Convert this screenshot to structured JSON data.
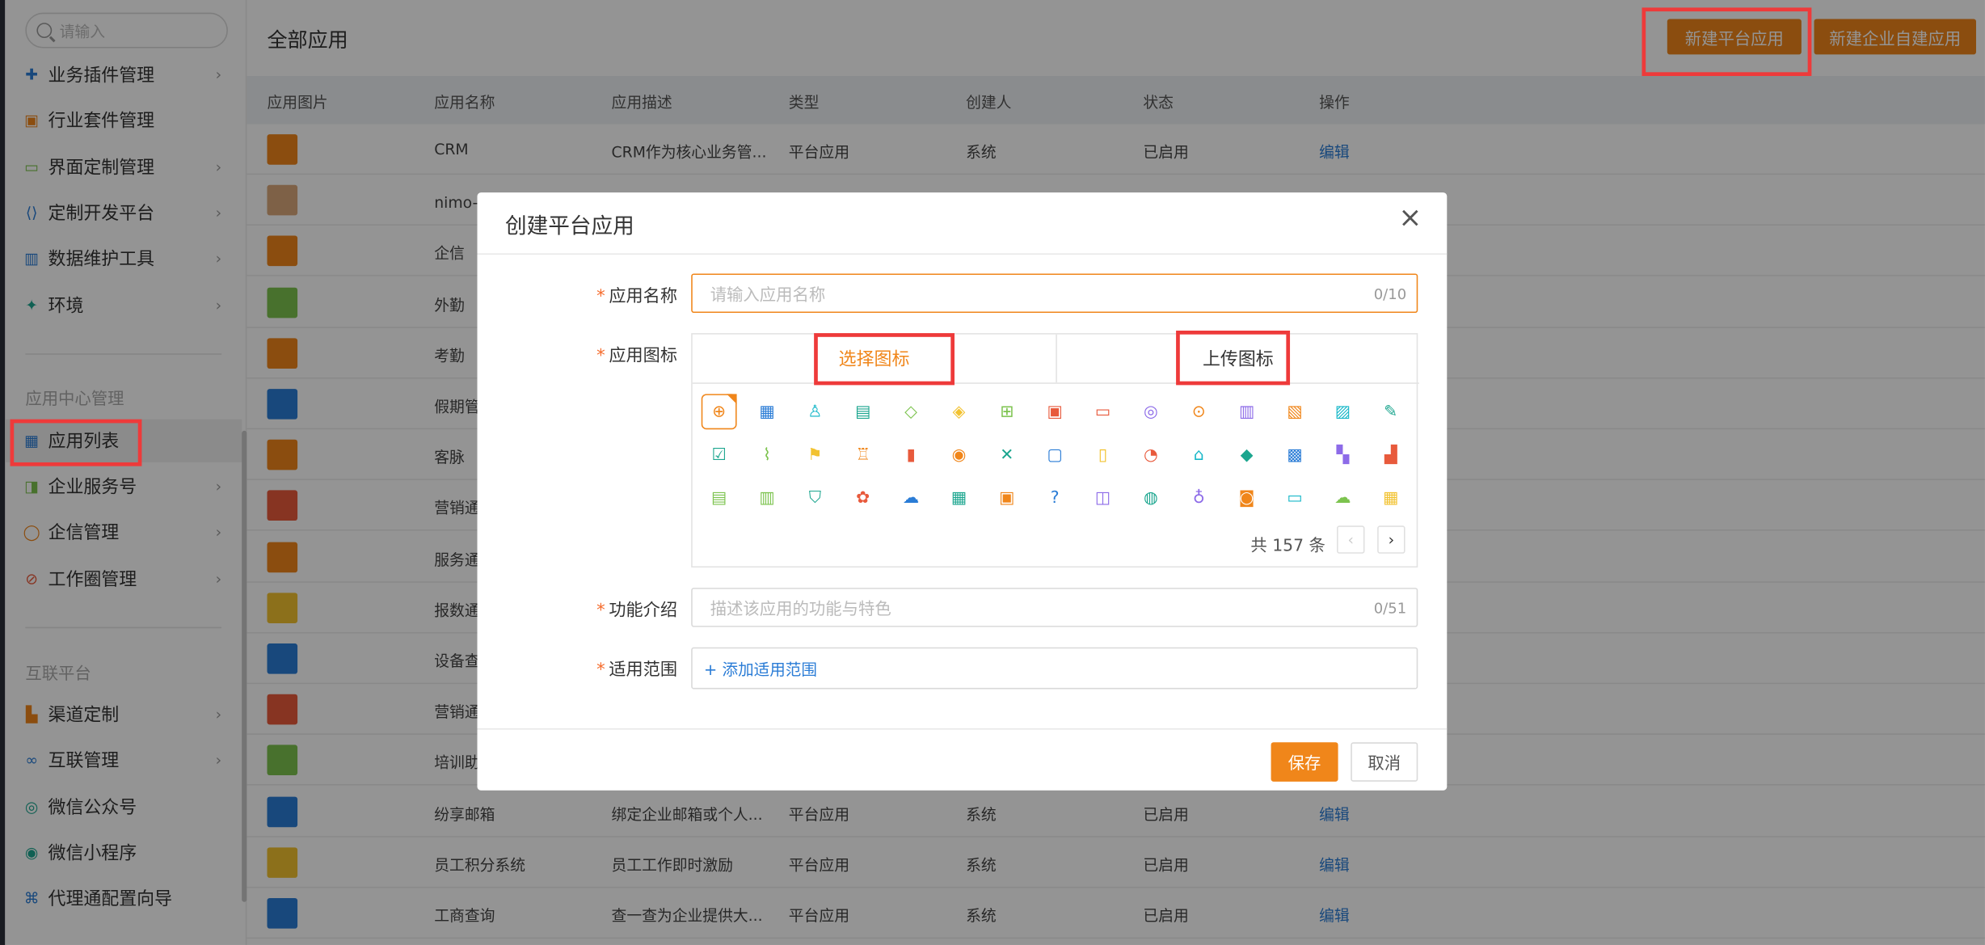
{
  "sidebar": {
    "search_placeholder": "请输入",
    "items": [
      {
        "label": "业务插件管理",
        "icon": "puzzle-icon",
        "chevron": true
      },
      {
        "label": "行业套件管理",
        "icon": "suite-icon",
        "chevron": false
      },
      {
        "label": "界面定制管理",
        "icon": "layout-icon",
        "chevron": true
      },
      {
        "label": "定制开发平台",
        "icon": "code-icon",
        "chevron": true
      },
      {
        "label": "数据维护工具",
        "icon": "bar-chart-icon",
        "chevron": true
      },
      {
        "label": "环境",
        "icon": "environment-icon",
        "chevron": true
      }
    ],
    "section_app_center": "应用中心管理",
    "app_items": [
      {
        "label": "应用列表",
        "icon": "grid-icon",
        "chevron": false
      },
      {
        "label": "企业服务号",
        "icon": "service-icon",
        "chevron": true
      },
      {
        "label": "企信管理",
        "icon": "chat-icon",
        "chevron": true
      },
      {
        "label": "工作圈管理",
        "icon": "edit-circle-icon",
        "chevron": true
      }
    ],
    "section_interconnect": "互联平台",
    "connect_items": [
      {
        "label": "渠道定制",
        "icon": "channel-icon",
        "chevron": true
      },
      {
        "label": "互联管理",
        "icon": "link-icon",
        "chevron": true
      },
      {
        "label": "微信公众号",
        "icon": "wechat-icon",
        "chevron": false
      },
      {
        "label": "微信小程序",
        "icon": "miniprogram-icon",
        "chevron": false
      },
      {
        "label": "代理通配置向导",
        "icon": "agent-icon",
        "chevron": false
      }
    ]
  },
  "main": {
    "title": "全部应用",
    "btn_new_platform": "新建平台应用",
    "btn_new_enterprise": "新建企业自建应用",
    "columns": [
      "应用图片",
      "应用名称",
      "应用描述",
      "类型",
      "创建人",
      "状态",
      "操作"
    ],
    "rows": [
      {
        "name": "CRM",
        "desc": "CRM作为核心业务管...",
        "type": "平台应用",
        "creator": "系统",
        "status": "已启用",
        "action": "编辑",
        "color": "#f0861a"
      },
      {
        "name": "nimo-测",
        "desc": "",
        "type": "",
        "creator": "",
        "status": "",
        "action": "",
        "color": "#d9a77a"
      },
      {
        "name": "企信",
        "desc": "",
        "type": "",
        "creator": "",
        "status": "",
        "action": "",
        "color": "#f0861a"
      },
      {
        "name": "外勤",
        "desc": "",
        "type": "",
        "creator": "",
        "status": "",
        "action": "",
        "color": "#7cc34e"
      },
      {
        "name": "考勤",
        "desc": "",
        "type": "",
        "creator": "",
        "status": "",
        "action": "",
        "color": "#f0861a"
      },
      {
        "name": "假期管",
        "desc": "",
        "type": "",
        "creator": "",
        "status": "",
        "action": "",
        "color": "#2a7cd6"
      },
      {
        "name": "客脉",
        "desc": "",
        "type": "",
        "creator": "",
        "status": "",
        "action": "",
        "color": "#f0861a"
      },
      {
        "name": "营销通",
        "desc": "",
        "type": "",
        "creator": "",
        "status": "",
        "action": "",
        "color": "#e85a3c"
      },
      {
        "name": "服务通",
        "desc": "",
        "type": "",
        "creator": "",
        "status": "",
        "action": "",
        "color": "#f0861a"
      },
      {
        "name": "报数通",
        "desc": "",
        "type": "",
        "creator": "",
        "status": "",
        "action": "",
        "color": "#f2c230"
      },
      {
        "name": "设备查",
        "desc": "",
        "type": "",
        "creator": "",
        "status": "",
        "action": "",
        "color": "#2a7cd6"
      },
      {
        "name": "营销通",
        "desc": "",
        "type": "",
        "creator": "",
        "status": "",
        "action": "",
        "color": "#e85a3c"
      },
      {
        "name": "培训助",
        "desc": "",
        "type": "",
        "creator": "",
        "status": "",
        "action": "",
        "color": "#7cc34e"
      },
      {
        "name": "纷享邮箱",
        "desc": "绑定企业邮箱或个人...",
        "type": "平台应用",
        "creator": "系统",
        "status": "已启用",
        "action": "编辑",
        "color": "#2a7cd6"
      },
      {
        "name": "员工积分系统",
        "desc": "员工工作即时激励",
        "type": "平台应用",
        "creator": "系统",
        "status": "已启用",
        "action": "编辑",
        "color": "#f2c230"
      },
      {
        "name": "工商查询",
        "desc": "查一查为企业提供大...",
        "type": "平台应用",
        "creator": "系统",
        "status": "已启用",
        "action": "编辑",
        "color": "#2a7cd6"
      }
    ]
  },
  "modal": {
    "title": "创建平台应用",
    "close": "×",
    "name_label": "应用名称",
    "name_placeholder": "请输入应用名称",
    "name_count": "0/10",
    "icon_label": "应用图标",
    "tab_select": "选择图标",
    "tab_upload": "上传图标",
    "icons": [
      {
        "glyph": "⊕",
        "color": "#f0861a",
        "selected": true
      },
      {
        "glyph": "▦",
        "color": "#2a7cd6"
      },
      {
        "glyph": "♙",
        "color": "#19b8c9"
      },
      {
        "glyph": "▤",
        "color": "#1ca68f"
      },
      {
        "glyph": "◇",
        "color": "#7cc34e"
      },
      {
        "glyph": "◈",
        "color": "#f2c230"
      },
      {
        "glyph": "⊞",
        "color": "#7cc34e"
      },
      {
        "glyph": "▣",
        "color": "#e85a3c"
      },
      {
        "glyph": "▭",
        "color": "#e85a3c"
      },
      {
        "glyph": "◎",
        "color": "#8d6be8"
      },
      {
        "glyph": "⊙",
        "color": "#f0861a"
      },
      {
        "glyph": "▥",
        "color": "#8d6be8"
      },
      {
        "glyph": "▧",
        "color": "#f0861a"
      },
      {
        "glyph": "▨",
        "color": "#19b8c9"
      },
      {
        "glyph": "✎",
        "color": "#1ca68f"
      },
      {
        "glyph": "☑",
        "color": "#1ca68f"
      },
      {
        "glyph": "⌇",
        "color": "#7cc34e"
      },
      {
        "glyph": "⚑",
        "color": "#f2c230"
      },
      {
        "glyph": "♖",
        "color": "#f0861a"
      },
      {
        "glyph": "▮",
        "color": "#e85a3c"
      },
      {
        "glyph": "◉",
        "color": "#f0861a"
      },
      {
        "glyph": "✕",
        "color": "#1ca68f"
      },
      {
        "glyph": "▢",
        "color": "#2a7cd6"
      },
      {
        "glyph": "▯",
        "color": "#f2c230"
      },
      {
        "glyph": "◔",
        "color": "#e85a3c"
      },
      {
        "glyph": "⌂",
        "color": "#19b8c9"
      },
      {
        "glyph": "◆",
        "color": "#1ca68f"
      },
      {
        "glyph": "▩",
        "color": "#2a7cd6"
      },
      {
        "glyph": "▚",
        "color": "#8d6be8"
      },
      {
        "glyph": "▟",
        "color": "#e85a3c"
      },
      {
        "glyph": "▤",
        "color": "#7cc34e"
      },
      {
        "glyph": "▥",
        "color": "#7cc34e"
      },
      {
        "glyph": "⛉",
        "color": "#1ca68f"
      },
      {
        "glyph": "✿",
        "color": "#e85a3c"
      },
      {
        "glyph": "☁",
        "color": "#2a7cd6"
      },
      {
        "glyph": "▦",
        "color": "#1ca68f"
      },
      {
        "glyph": "▣",
        "color": "#f0861a"
      },
      {
        "glyph": "?",
        "color": "#2a7cd6"
      },
      {
        "glyph": "◫",
        "color": "#8d6be8"
      },
      {
        "glyph": "◍",
        "color": "#1ca68f"
      },
      {
        "glyph": "♁",
        "color": "#8d6be8"
      },
      {
        "glyph": "◙",
        "color": "#f0861a"
      },
      {
        "glyph": "▭",
        "color": "#19b8c9"
      },
      {
        "glyph": "☁",
        "color": "#7cc34e"
      },
      {
        "glyph": "▦",
        "color": "#f2c230"
      }
    ],
    "total": "共 157 条",
    "prev": "‹",
    "next": "›",
    "desc_label": "功能介绍",
    "desc_placeholder": "描述该应用的功能与特色",
    "desc_count": "0/51",
    "scope_label": "适用范围",
    "scope_add": "+ 添加适用范围",
    "save": "保存",
    "cancel": "取消",
    "required_mark": "*"
  }
}
